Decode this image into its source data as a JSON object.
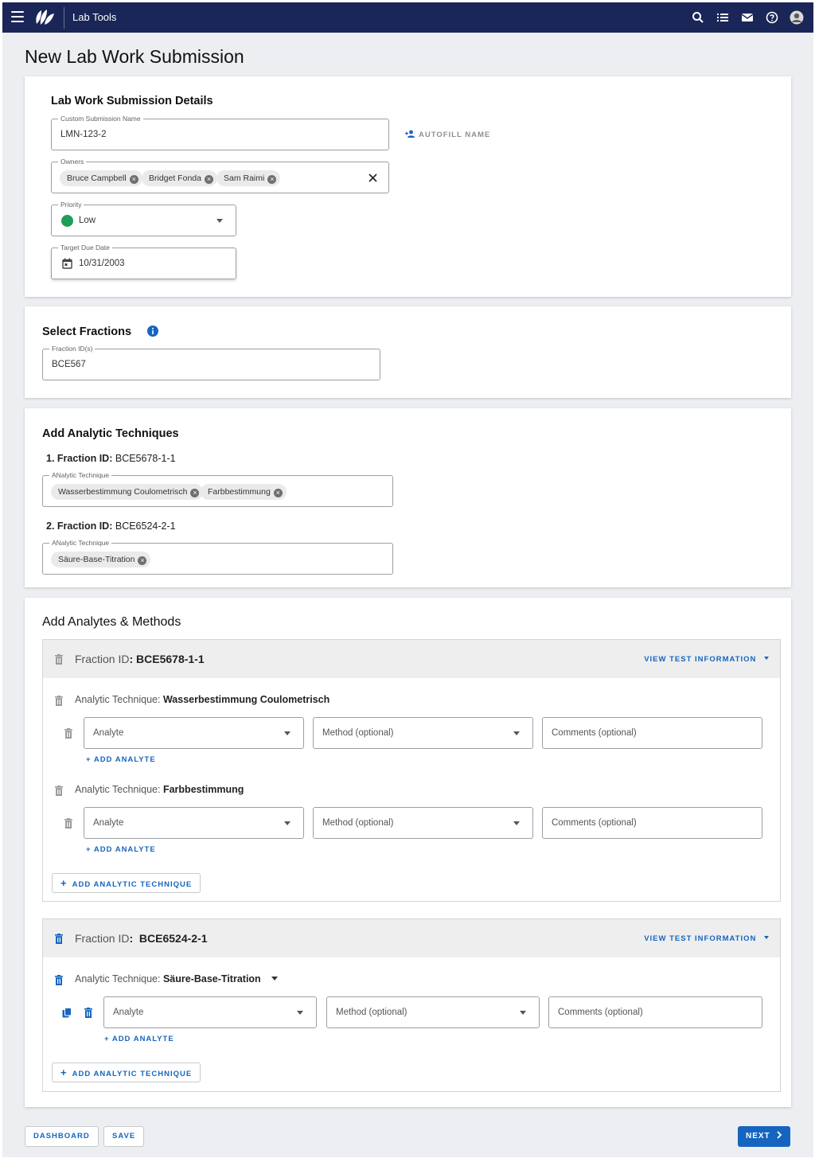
{
  "header": {
    "app_title": "Lab Tools",
    "icons": [
      "menu-icon",
      "logo-icon",
      "search-icon",
      "list-icon",
      "mail-icon",
      "help-icon",
      "avatar"
    ]
  },
  "page": {
    "title": "New Lab Work Submission"
  },
  "details": {
    "heading": "Lab Work Submission Details",
    "custom_name_label": "Custom Submission Name",
    "custom_name_value": "LMN-123-2",
    "autofill_label": "AUTOFILL NAME",
    "owners_label": "Owners",
    "owners": [
      "Bruce Campbell",
      "Bridget Fonda",
      "Sam Raimi"
    ],
    "priority_label": "Priority",
    "priority_value": "Low",
    "priority_color": "#1e9e57",
    "due_date_label": "Target Due Date",
    "due_date_value": "10/31/2003"
  },
  "fractions": {
    "heading": "Select Fractions",
    "field_label": "Fraction ID(s)",
    "field_value": "BCE567"
  },
  "techniques": {
    "heading": "Add Analytic Techniques",
    "field_label": "ANalytic Technique",
    "items": [
      {
        "number": "1.",
        "prefix": "Fraction ID:",
        "id": "BCE5678-1-1",
        "chips": [
          "Wasserbestimmung Coulometrisch",
          "Farbbestimmung"
        ]
      },
      {
        "number": "2.",
        "prefix": "Fraction ID:",
        "id": "BCE6524-2-1",
        "chips": [
          "Säure-Base-Titration"
        ]
      }
    ]
  },
  "analytes": {
    "heading": "Add Analytes & Methods",
    "view_info_label": "VIEW TEST INFORMATION",
    "add_analyte_label": "+ ADD ANALYTE",
    "add_technique_label": "ADD ANALYTIC TECHNIQUE",
    "analyte_placeholder": "Analyte",
    "method_placeholder": "Method (optional)",
    "comments_placeholder": "Comments (optional)",
    "tech_prefix": "Analytic Technique:",
    "fraction1": {
      "prefix": "Fraction ID",
      "id": ": BCE5678-1-1",
      "techniques": [
        "Wasserbestimmung Coulometrisch",
        "Farbbestimmung"
      ]
    },
    "fraction2": {
      "prefix": "Fraction ID",
      "id": ":  BCE6524-2-1",
      "techniques": [
        "Säure-Base-Titration"
      ]
    }
  },
  "footer": {
    "dashboard_label": "DASHBOARD",
    "save_label": "SAVE",
    "next_label": "NEXT"
  },
  "colors": {
    "nav": "#1a2657",
    "accent": "#1565c0"
  }
}
